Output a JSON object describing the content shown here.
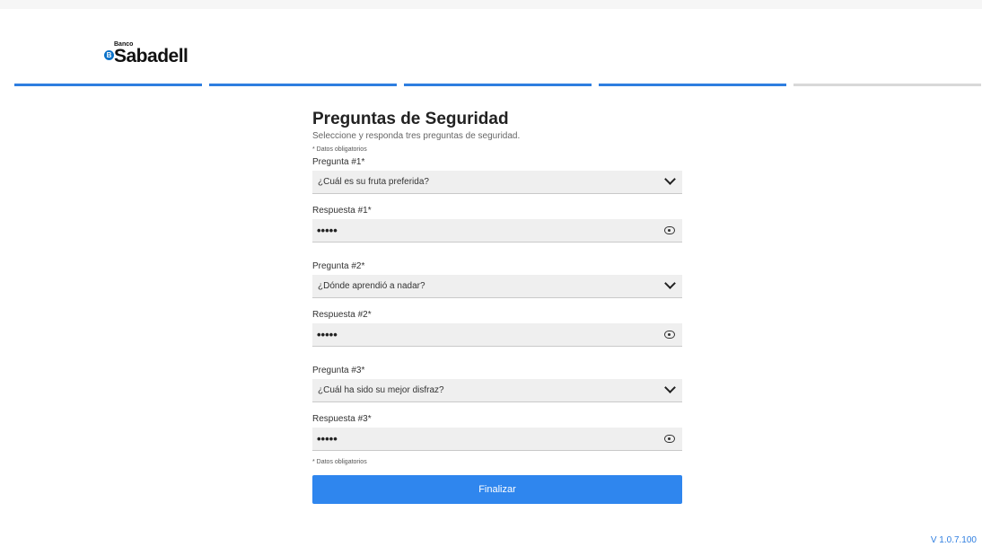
{
  "brand": {
    "small": "Banco",
    "name": "Sabadell",
    "badge": "B"
  },
  "progress_steps": [
    "done",
    "done",
    "done",
    "done",
    "todo"
  ],
  "form": {
    "title": "Preguntas de Seguridad",
    "subtitle": "Seleccione y responda tres preguntas de seguridad.",
    "required_note": "* Datos obligatorios",
    "q1_label": "Pregunta #1*",
    "q1_value": "¿Cuál es su fruta preferida?",
    "a1_label": "Respuesta #1*",
    "a1_value": "•••••",
    "q2_label": "Pregunta #2*",
    "q2_value": "¿Dónde aprendió a nadar?",
    "a2_label": "Respuesta #2*",
    "a2_value": "•••••",
    "q3_label": "Pregunta #3*",
    "q3_value": "¿Cuál ha sido su mejor disfraz?",
    "a3_label": "Respuesta #3*",
    "a3_value": "•••••",
    "required_note_bottom": "* Datos obligatorios",
    "submit_label": "Finalizar"
  },
  "version": "V 1.0.7.100",
  "colors": {
    "accent": "#2e7ee0",
    "button": "#2f86ee",
    "field_bg": "#efefef"
  }
}
